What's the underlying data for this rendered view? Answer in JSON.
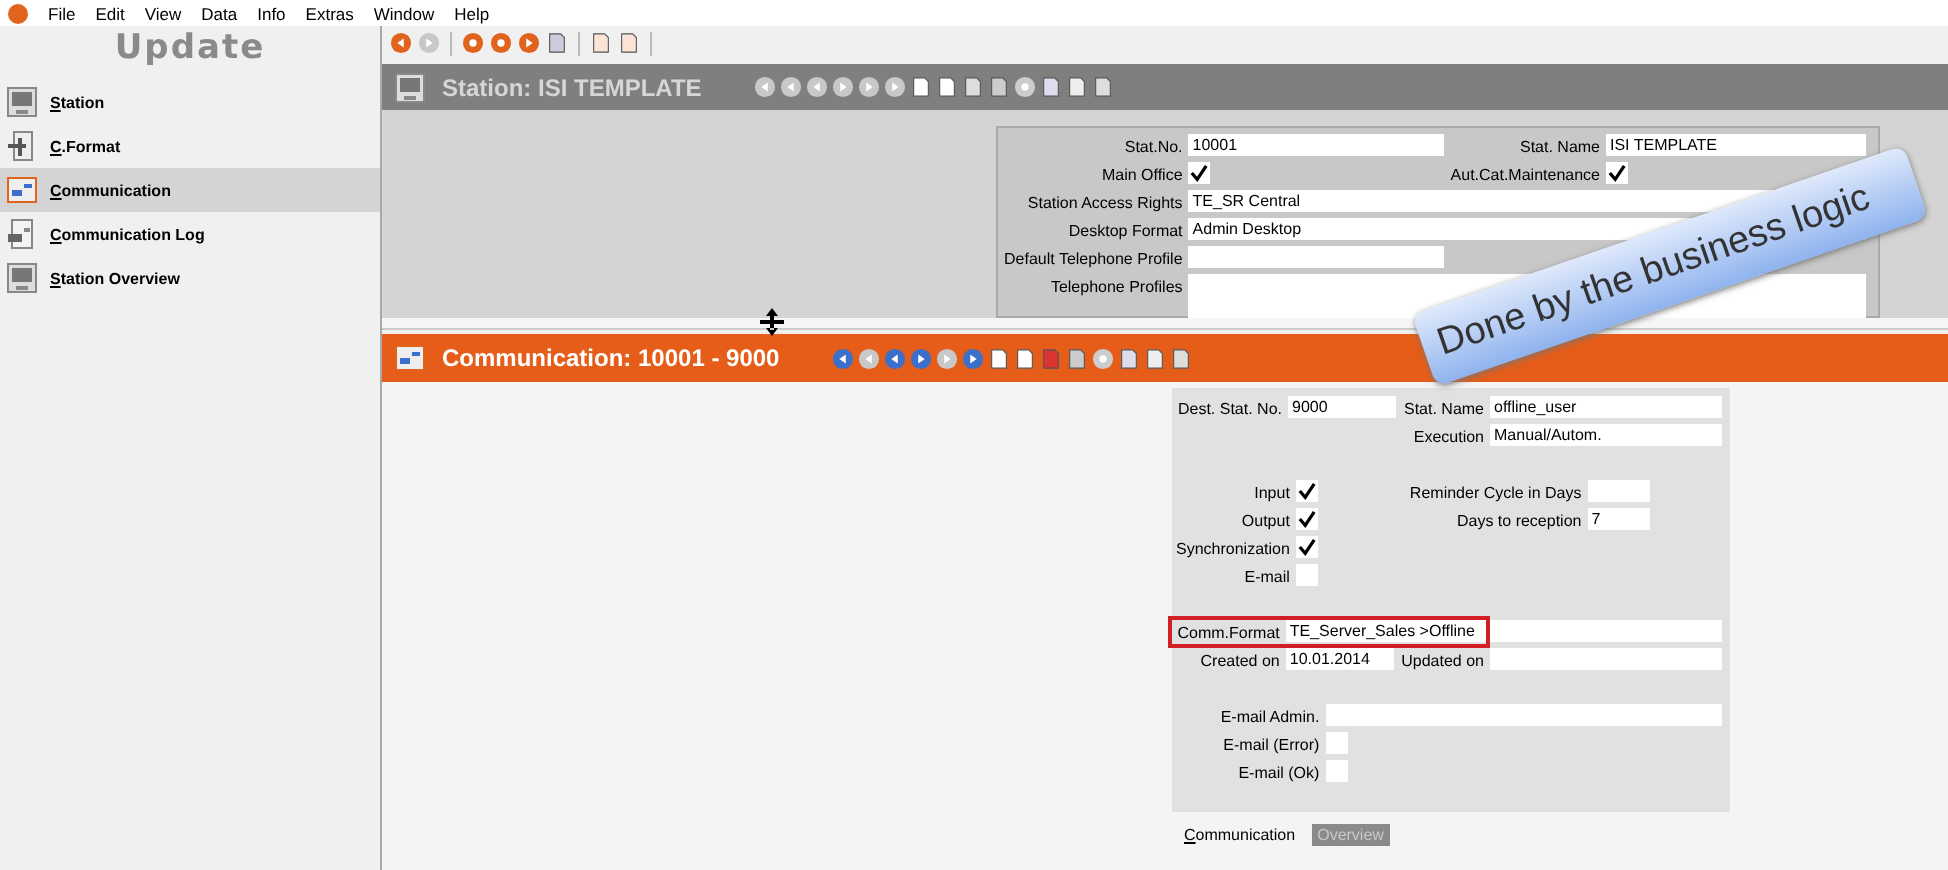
{
  "menu": [
    "File",
    "Edit",
    "View",
    "Data",
    "Info",
    "Extras",
    "Window",
    "Help"
  ],
  "logo": "Update",
  "sidebar": {
    "items": [
      {
        "label": "Station",
        "selected": false
      },
      {
        "label": "C.Format",
        "selected": false
      },
      {
        "label": "Communication",
        "selected": true
      },
      {
        "label": "Communication Log",
        "selected": false
      },
      {
        "label": "Station Overview",
        "selected": false
      }
    ]
  },
  "station": {
    "title": "Station: ISI TEMPLATE",
    "rows": [
      {
        "left": {
          "label": "Stat.No.",
          "kind": "text",
          "value": "10001"
        },
        "right": {
          "label": "Stat. Name",
          "kind": "text",
          "value": "ISI TEMPLATE"
        }
      },
      {
        "left": {
          "label": "Main Office",
          "kind": "check",
          "checked": true
        },
        "right": {
          "label": "Aut.Cat.Maintenance",
          "kind": "check",
          "checked": true
        }
      },
      {
        "left": {
          "label": "Station Access Rights",
          "kind": "wide",
          "value": "TE_SR Central"
        }
      },
      {
        "left": {
          "label": "Desktop Format",
          "kind": "wide",
          "value": "Admin Desktop"
        }
      },
      {
        "left": {
          "label": "Default Telephone Profile",
          "kind": "text"
        }
      },
      {
        "left": {
          "label": "Telephone Profiles",
          "kind": "area"
        }
      }
    ]
  },
  "communication": {
    "title": "Communication: 10001 - 9000",
    "sections": [
      [
        {
          "left": {
            "label": "Dest. Stat. No.",
            "kind": "text",
            "value": "9000"
          },
          "right": {
            "label": "Stat. Name",
            "kind": "wide",
            "value": "offline_user"
          }
        },
        {
          "right": {
            "label": "Execution",
            "kind": "wide",
            "value": "Manual/Autom."
          }
        }
      ],
      [
        {
          "left": {
            "label": "Input",
            "kind": "check",
            "checked": true
          },
          "right": {
            "label": "Reminder Cycle in Days",
            "kind": "small"
          }
        },
        {
          "left": {
            "label": "Output",
            "kind": "check",
            "checked": true
          },
          "right": {
            "label": "Days to reception",
            "kind": "small",
            "value": "7"
          }
        },
        {
          "left": {
            "label": "Synchronization",
            "kind": "check",
            "checked": true
          }
        },
        {
          "left": {
            "label": "E-mail",
            "kind": "check",
            "checked": false
          }
        }
      ],
      [
        {
          "left": {
            "label": "Comm.Format",
            "kind": "wide",
            "value": "TE_Server_Sales >Offline",
            "highlighted": true
          }
        },
        {
          "left": {
            "label": "Created on",
            "kind": "text",
            "value": "10.01.2014"
          },
          "right": {
            "label": "Updated on",
            "kind": "text"
          }
        }
      ],
      [
        {
          "left": {
            "label": "E-mail Admin.",
            "kind": "wide"
          }
        },
        {
          "left": {
            "label": "E-mail (Error)",
            "kind": "check",
            "checked": false
          }
        },
        {
          "left": {
            "label": "E-mail (Ok)",
            "kind": "check",
            "checked": false
          }
        }
      ]
    ]
  },
  "tabs": [
    {
      "label": "Communication",
      "selected": true
    },
    {
      "label": "Overview",
      "selected": false
    }
  ],
  "callout": {
    "text": "Done by the business logic"
  }
}
